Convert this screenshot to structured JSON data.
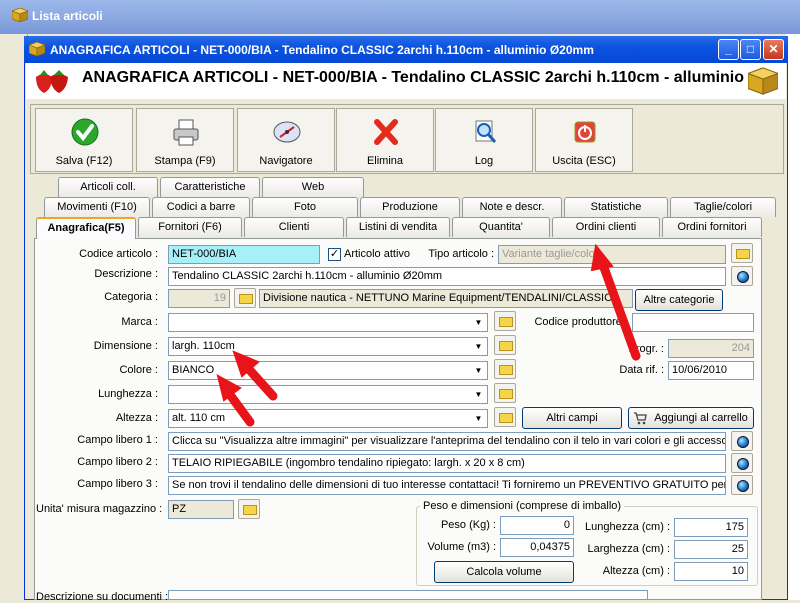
{
  "background_window": {
    "title": "Lista articoli"
  },
  "window": {
    "title": "ANAGRAFICA ARTICOLI - NET-000/BIA - Tendalino CLASSIC 2archi h.110cm - alluminio Ø20mm"
  },
  "header": {
    "title": "ANAGRAFICA ARTICOLI - NET-000/BIA - Tendalino CLASSIC 2archi h.110cm - alluminio"
  },
  "toolbar": {
    "save": "Salva (F12)",
    "print": "Stampa (F9)",
    "navigator": "Navigatore",
    "delete": "Elimina",
    "log": "Log",
    "exit": "Uscita (ESC)"
  },
  "tabs": {
    "row1": [
      "Articoli coll.",
      "Caratteristiche",
      "Web"
    ],
    "row2": [
      "Movimenti (F10)",
      "Codici a barre",
      "Foto",
      "Produzione",
      "Note e descr.",
      "Statistiche",
      "Taglie/colori"
    ],
    "row3": [
      "Anagrafica(F5)",
      "Fornitori (F6)",
      "Clienti",
      "Listini di vendita",
      "Quantita'",
      "Ordini clienti",
      "Ordini fornitori"
    ]
  },
  "form": {
    "codice_label": "Codice articolo :",
    "codice_value": "NET-000/BIA",
    "attivo_label": "Articolo attivo",
    "tipo_label": "Tipo articolo :",
    "tipo_value": "Variante taglie/colori",
    "descrizione_label": "Descrizione :",
    "descrizione_value": "Tendalino CLASSIC 2archi h.110cm - alluminio Ø20mm",
    "categoria_label": "Categoria :",
    "categoria_num": "19",
    "categoria_value": "Divisione nautica - NETTUNO Marine Equipment/TENDALINI/CLASSIC",
    "altre_categorie": "Altre categorie",
    "marca_label": "Marca :",
    "marca_value": "",
    "codice_produttore_label": "Codice produttore :",
    "dimensione_label": "Dimensione :",
    "dimensione_value": "largh. 110cm",
    "progr_label": "Progr. :",
    "progr_value": "204",
    "colore_label": "Colore :",
    "colore_value": "BIANCO",
    "data_rif_label": "Data rif. :",
    "data_rif_value": "10/06/2010",
    "lunghezza_label": "Lunghezza :",
    "lunghezza_value": "",
    "altezza_label": "Altezza :",
    "altezza_value": "alt. 110 cm",
    "altri_campi": "Altri campi",
    "aggiungi_carrello": "Aggiungi al carrello",
    "campo1_label": "Campo libero 1 :",
    "campo1_value": "Clicca su \"Visualizza altre immagini\" per visualizzare l'anteprima del tendalino con il telo in vari colori e gli accessori",
    "campo2_label": "Campo libero 2 :",
    "campo2_value": "TELAIO RIPIEGABILE (ingombro tendalino ripiegato: largh. x 20 x 8 cm)",
    "campo3_label": "Campo libero 3 :",
    "campo3_value": "Se non trovi il tendalino delle dimensioni di tuo interesse contattaci! Ti forniremo un PREVENTIVO GRATUITO per un",
    "um_label": "Unita' misura magazzino :",
    "um_value": "PZ",
    "descr_doc_label": "Descrizione su documenti :"
  },
  "peso_group": {
    "title": "Peso e dimensioni (comprese di imballo)",
    "peso_label": "Peso (Kg) :",
    "peso_value": "0",
    "volume_label": "Volume (m3) :",
    "volume_value": "0,04375",
    "calcola": "Calcola volume",
    "lunghezza_label": "Lunghezza (cm) :",
    "lunghezza_value": "175",
    "larghezza_label": "Larghezza (cm) :",
    "larghezza_value": "25",
    "altezza_label": "Altezza (cm) :",
    "altezza_value": "10"
  },
  "colors": {
    "title_blue": "#0a54e0",
    "cyan_field": "#a8f0f8",
    "arrow_red": "#e8141a"
  }
}
